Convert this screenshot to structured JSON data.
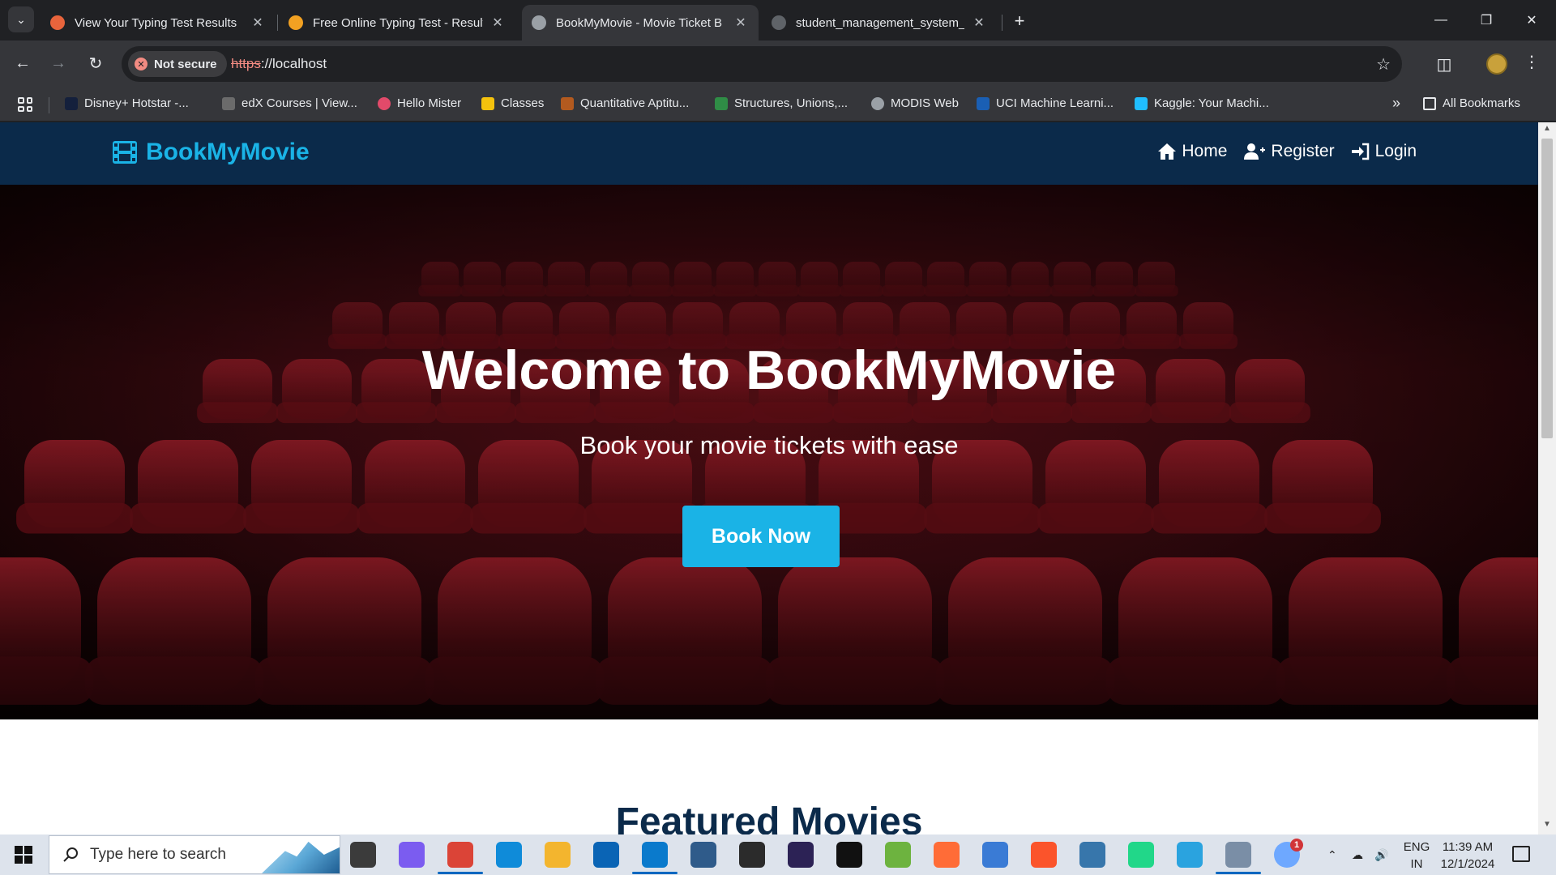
{
  "browser": {
    "tabs": [
      {
        "title": "View Your Typing Test Results",
        "favicon_color": "#e8643c"
      },
      {
        "title": "Free Online Typing Test - Result",
        "favicon_color": "#f2a122"
      },
      {
        "title": "BookMyMovie - Movie Ticket B",
        "favicon_color": "#9aa0a6"
      },
      {
        "title": "student_management_system_s",
        "favicon_color": "#5f6368"
      }
    ],
    "security_label": "Not secure",
    "url_scheme": "https",
    "url_rest": "://localhost",
    "bookmarks": [
      {
        "label": "Disney+ Hotstar -...",
        "color": "#14203c"
      },
      {
        "label": "edX Courses | View...",
        "color": "#6b6b6b"
      },
      {
        "label": "Hello Mister",
        "color": "#e24a6a"
      },
      {
        "label": "Classes",
        "color": "#f4c20d"
      },
      {
        "label": "Quantitative Aptitu...",
        "color": "#b35a1f"
      },
      {
        "label": "Structures, Unions,...",
        "color": "#2f8d46"
      },
      {
        "label": "MODIS Web",
        "color": "#9aa0a6"
      },
      {
        "label": "UCI Machine Learni...",
        "color": "#1a5fb4"
      },
      {
        "label": "Kaggle: Your Machi...",
        "color": "#20beff"
      }
    ],
    "all_bookmarks": "All Bookmarks"
  },
  "site": {
    "brand": "BookMyMovie",
    "nav": {
      "home": "Home",
      "register": "Register",
      "login": "Login"
    },
    "hero": {
      "title": "Welcome to BookMyMovie",
      "subtitle": "Book your movie tickets with ease",
      "cta": "Book Now"
    },
    "featured_heading": "Featured Movies",
    "colors": {
      "navy": "#0b2a4a",
      "accent": "#1ab3e6",
      "seat_red": "#8c1a24"
    }
  },
  "taskbar": {
    "search_placeholder": "Type here to search",
    "lang_line1": "ENG",
    "lang_line2": "IN",
    "time": "11:39 AM",
    "date": "12/1/2024",
    "notification_badge": "1",
    "apps": [
      {
        "name": "task-view",
        "color": "#3b3b3b"
      },
      {
        "name": "copilot",
        "color": "#7b5cf0"
      },
      {
        "name": "chrome",
        "color": "#db4437"
      },
      {
        "name": "edge",
        "color": "#0f8bd9"
      },
      {
        "name": "file-explorer",
        "color": "#f3b52e"
      },
      {
        "name": "outlook",
        "color": "#0a64b5"
      },
      {
        "name": "vscode",
        "color": "#0a7acc"
      },
      {
        "name": "mysql-workbench",
        "color": "#2f5b8a"
      },
      {
        "name": "terminal-app",
        "color": "#2b2b2b"
      },
      {
        "name": "eclipse",
        "color": "#2c2255"
      },
      {
        "name": "intellij",
        "color": "#111111"
      },
      {
        "name": "spring-tool",
        "color": "#6db33f"
      },
      {
        "name": "postman",
        "color": "#ff6c37"
      },
      {
        "name": "notepad",
        "color": "#3a7bd5"
      },
      {
        "name": "brave",
        "color": "#fb542b"
      },
      {
        "name": "python-idle",
        "color": "#3776ab"
      },
      {
        "name": "pycharm",
        "color": "#21d789"
      },
      {
        "name": "telegram",
        "color": "#2aa3df"
      },
      {
        "name": "settings-tool",
        "color": "#7a8ea6"
      },
      {
        "name": "weather",
        "color": "#6ea8ff"
      }
    ]
  }
}
